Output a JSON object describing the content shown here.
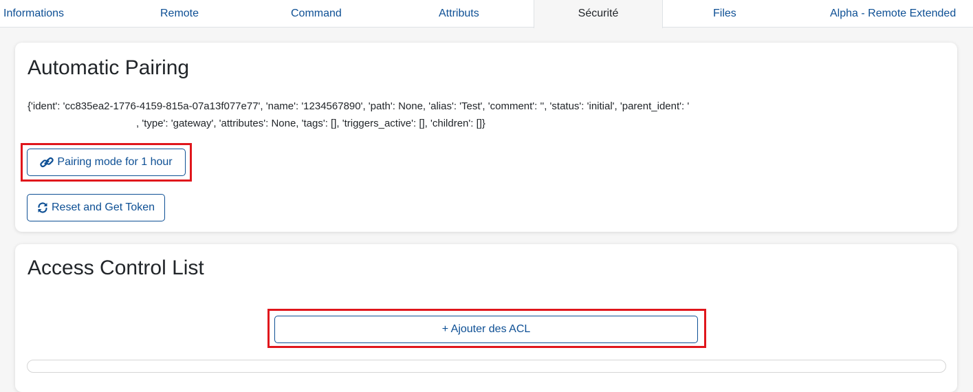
{
  "tabs": [
    {
      "label": "Informations"
    },
    {
      "label": "Remote"
    },
    {
      "label": "Command"
    },
    {
      "label": "Attributs"
    },
    {
      "label": "Sécurité"
    },
    {
      "label": "Files"
    },
    {
      "label": "Alpha - Remote Extended"
    }
  ],
  "active_tab": "Sécurité",
  "pairing": {
    "title": "Automatic Pairing",
    "json_line1": "{'ident': 'cc835ea2-1776-4159-815a-07a13f077e77', 'name': '1234567890', 'path': None, 'alias': 'Test', 'comment': '', 'status': 'initial', 'parent_ident': '",
    "json_line2": ", 'type': 'gateway', 'attributes': None, 'tags': [], 'triggers_active': [], 'children': []}",
    "pairing_button": "Pairing mode for 1 hour",
    "pairing_icon": "link-icon",
    "reset_button": "Reset and Get Token",
    "reset_icon": "refresh-icon"
  },
  "acl": {
    "title": "Access Control List",
    "add_button": "+ Ajouter des ACL"
  },
  "colors": {
    "accent": "#0d4f94",
    "highlight": "#e0161c",
    "background": "#f6f6f6"
  }
}
